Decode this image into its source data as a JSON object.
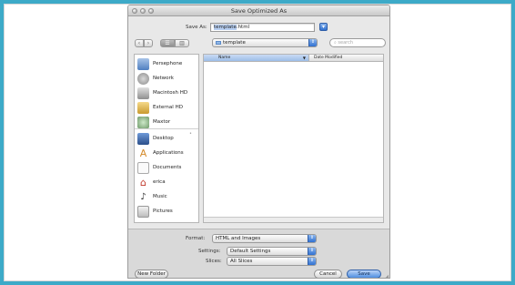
{
  "window": {
    "title": "Save Optimized As"
  },
  "save_as": {
    "label": "Save As:",
    "value": "template.html",
    "selected_part": "template"
  },
  "navigation": {
    "back_icon": "chevron-left-icon",
    "forward_icon": "chevron-right-icon",
    "view_icons": "view-mode-icon"
  },
  "location": {
    "folder": "template"
  },
  "search": {
    "placeholder": "search"
  },
  "sidebar": {
    "devices": [
      {
        "label": "Persephone",
        "icon": "computer-icon"
      },
      {
        "label": "Network",
        "icon": "network-icon"
      },
      {
        "label": "Macintosh HD",
        "icon": "hard-drive-icon"
      },
      {
        "label": "External HD",
        "icon": "external-drive-icon"
      },
      {
        "label": "Maxtor",
        "icon": "network-drive-icon"
      }
    ],
    "places": [
      {
        "label": "Desktop",
        "icon": "desktop-icon"
      },
      {
        "label": "Applications",
        "icon": "applications-icon"
      },
      {
        "label": "Documents",
        "icon": "documents-icon"
      },
      {
        "label": "erica",
        "icon": "home-icon"
      },
      {
        "label": "Music",
        "icon": "music-icon"
      },
      {
        "label": "Pictures",
        "icon": "pictures-icon"
      }
    ]
  },
  "file_list": {
    "columns": [
      "Name",
      "Date Modified"
    ]
  },
  "options": {
    "format": {
      "label": "Format:",
      "value": "HTML and Images"
    },
    "settings": {
      "label": "Settings:",
      "value": "Default Settings"
    },
    "slices": {
      "label": "Slices:",
      "value": "All Slices"
    }
  },
  "buttons": {
    "new_folder": "New Folder",
    "cancel": "Cancel",
    "save": "Save"
  },
  "colors": {
    "background": "#3daac8",
    "accent": "#2f70d0"
  }
}
